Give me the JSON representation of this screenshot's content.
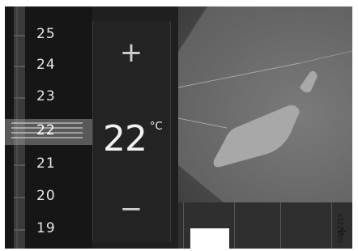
{
  "scale": {
    "labels": [
      "25",
      "24",
      "23",
      "22",
      "21",
      "20",
      "19"
    ],
    "selected": "22"
  },
  "controls": {
    "increase_symbol": "+",
    "decrease_symbol": "−"
  },
  "temperature": {
    "value": "22",
    "unit": "°C"
  },
  "figure_code": "G052215",
  "icons": {
    "seat": "seat-icon",
    "fan": "fan-icon"
  }
}
